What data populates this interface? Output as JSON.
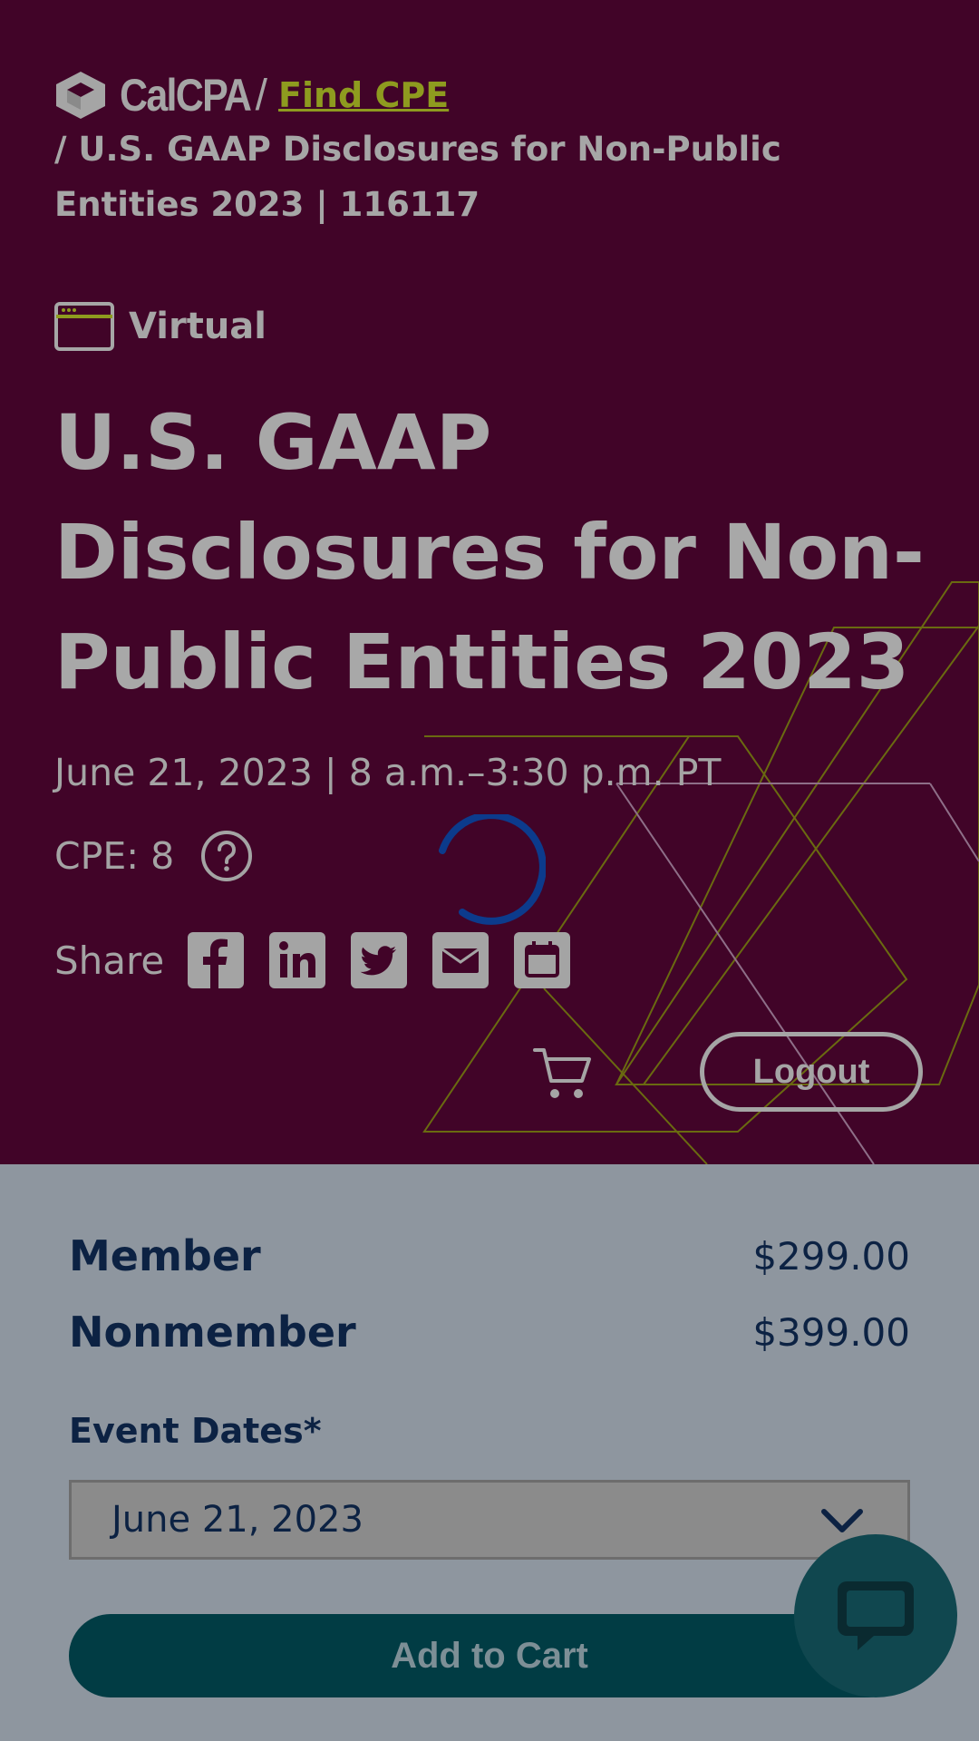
{
  "header": {
    "logo_text": "CalCPA",
    "breadcrumb_sep": "/",
    "breadcrumb_link": "Find CPE",
    "breadcrumb_current": "/ U.S. GAAP Disclosures for Non-Public Entities 2023 | 116117"
  },
  "event": {
    "format": "Virtual",
    "title": "U.S. GAAP Disclosures for Non-Public Entities 2023",
    "date_time": "June 21, 2023 | 8 a.m.–3:30 p.m. PT",
    "cpe": "CPE: 8"
  },
  "share": {
    "label": "Share",
    "icons": [
      "facebook-icon",
      "linkedin-icon",
      "twitter-icon",
      "email-icon",
      "calendar-icon"
    ]
  },
  "actions": {
    "logout_label": "Logout"
  },
  "pricing": {
    "member_label": "Member",
    "member_price": "$299.00",
    "nonmember_label": "Nonmember",
    "nonmember_price": "$399.00"
  },
  "registration": {
    "dates_label": "Event Dates*",
    "selected_date": "June 21, 2023",
    "add_to_cart_label": "Add to Cart"
  },
  "colors": {
    "hero_bg": "#410428",
    "accent_link": "#8e9b1f",
    "panel_bg": "#8e969f",
    "button_bg": "#013c44",
    "text_dark": "#0c2243"
  }
}
